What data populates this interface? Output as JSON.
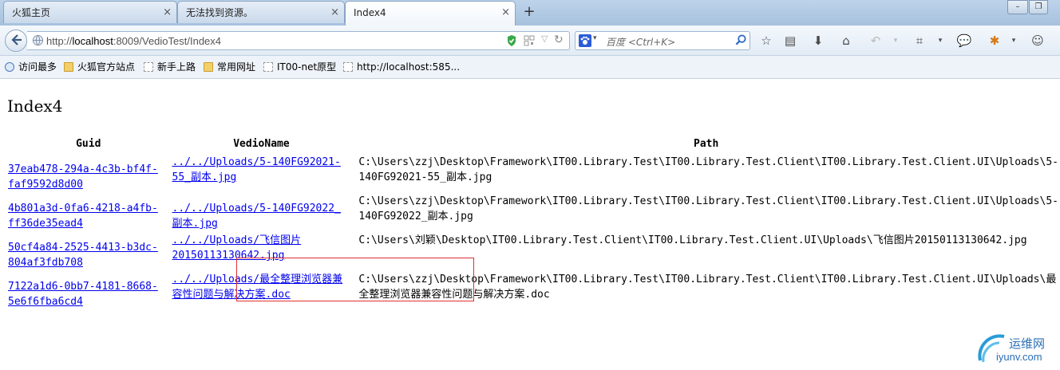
{
  "tabs": [
    {
      "title": "火狐主页",
      "close": "×"
    },
    {
      "title": "无法找到资源。",
      "close": "×"
    },
    {
      "title": "Index4",
      "close": "×"
    }
  ],
  "new_tab_label": "+",
  "window_controls": {
    "minimize": "–",
    "restore": "❐"
  },
  "navbar": {
    "url_prefix": "http://",
    "url_host": "localhost",
    "url_rest": ":8009/VedioTest/Index4",
    "search_placeholder": "百度 <Ctrl+K>"
  },
  "icons": {
    "back": "back-arrow-icon",
    "site": "globe-icon",
    "shield": "shield-icon",
    "qr": "qrcode-icon",
    "dropdown": "chevron-down-icon",
    "reload": "reload-icon",
    "search_engine": "baidu-paw-icon",
    "search": "magnifier-icon",
    "bookmark_star": "star-icon",
    "reading_list": "reading-list-icon",
    "downloads": "download-icon",
    "home": "home-icon",
    "undo": "undo-icon",
    "crop": "crop-icon",
    "chat": "chat-bubble-icon",
    "addon": "addon-icon",
    "smiley": "smiley-icon"
  },
  "bookmarks": [
    {
      "label": "访问最多",
      "icon": "most-visited-icon"
    },
    {
      "label": "火狐官方站点",
      "icon": "folder-icon"
    },
    {
      "label": "新手上路",
      "icon": "page-icon"
    },
    {
      "label": "常用网址",
      "icon": "folder-icon"
    },
    {
      "label": "IT00-net原型",
      "icon": "page-icon"
    },
    {
      "label": "http://localhost:585...",
      "icon": "page-icon"
    }
  ],
  "page": {
    "title": "Index4",
    "columns": [
      "Guid",
      "VedioName",
      "Path"
    ],
    "rows": [
      {
        "guid": "37eab478-294a-4c3b-bf4f-faf9592d8d00",
        "name": "../../Uploads/5-140FG92021-55_副本.jpg",
        "path": "C:\\Users\\zzj\\Desktop\\Framework\\IT00.Library.Test\\IT00.Library.Test.Client\\IT00.Library.Test.Client.UI\\Uploads\\5-140FG92021-55_副本.jpg"
      },
      {
        "guid": "4b801a3d-0fa6-4218-a4fb-ff36de35ead4",
        "name": "../../Uploads/5-140FG92022_副本.jpg",
        "path": "C:\\Users\\zzj\\Desktop\\Framework\\IT00.Library.Test\\IT00.Library.Test.Client\\IT00.Library.Test.Client.UI\\Uploads\\5-140FG92022_副本.jpg"
      },
      {
        "guid": "50cf4a84-2525-4413-b3dc-804af3fdb708",
        "name": "../../Uploads/飞信图片20150113130642.jpg",
        "path": "C:\\Users\\刘颖\\Desktop\\IT00.Library.Test.Client\\IT00.Library.Test.Client.UI\\Uploads\\飞信图片20150113130642.jpg"
      },
      {
        "guid": "7122a1d6-0bb7-4181-8668-5e6f6fba6cd4",
        "name": "../../Uploads/最全整理浏览器兼容性问题与解决方案.doc",
        "path": "C:\\Users\\zzj\\Desktop\\Framework\\IT00.Library.Test\\IT00.Library.Test.Client\\IT00.Library.Test.Client.UI\\Uploads\\最全整理浏览器兼容性问题与解决方案.doc"
      }
    ]
  },
  "watermark": {
    "line1": "运维网",
    "line2": "iyunv.com"
  },
  "colors": {
    "link": "#0000ee",
    "highlight_border": "#e03030",
    "tabstrip": "#b3cbe4"
  }
}
